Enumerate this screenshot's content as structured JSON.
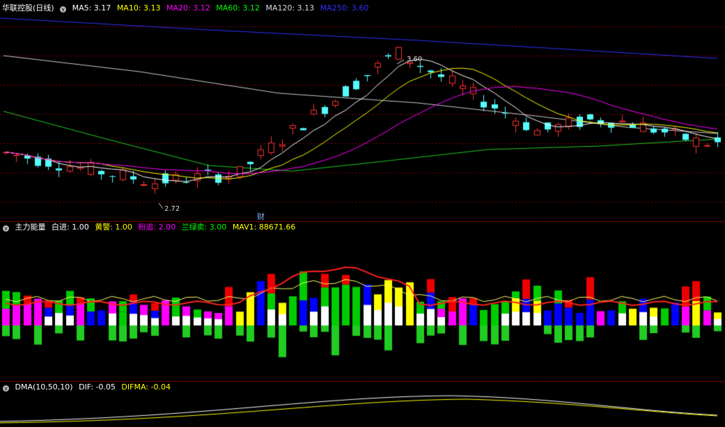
{
  "main": {
    "title": "华联控股(日线)",
    "ma": [
      {
        "label": "MA5: 3.17",
        "color": "#ffffff"
      },
      {
        "label": "MA10: 3.13",
        "color": "#ffff00"
      },
      {
        "label": "MA20: 3.12",
        "color": "#ff00ff"
      },
      {
        "label": "MA60: 3.12",
        "color": "#00ff00"
      },
      {
        "label": "MA120: 3.13",
        "color": "#dddddd"
      },
      {
        "label": "MA250: 3.60",
        "color": "#3030ff"
      }
    ],
    "high_note": "3.60",
    "low_note": "2.72",
    "finance_marker": "财"
  },
  "energy": {
    "title": "主力能量",
    "items": [
      {
        "label": "白进: 1.00",
        "color": "#ffffff"
      },
      {
        "label": "黄警: 1.00",
        "color": "#ffff00"
      },
      {
        "label": "粉追: 2.00",
        "color": "#ff00ff"
      },
      {
        "label": "兰绿卖: 3.00",
        "color": "#00ff00"
      },
      {
        "label": "MAV1: 88671.66",
        "color": "#ffff00"
      }
    ]
  },
  "dma": {
    "title": "DMA(10,50,10)",
    "items": [
      {
        "label": "DIF: -0.05",
        "color": "#ffffff"
      },
      {
        "label": "DIFMA: -0.04",
        "color": "#ffff00"
      }
    ]
  },
  "colors": {
    "up": "#ff3030",
    "down": "#54fcfc",
    "grid": "#8b0000",
    "bg": "#000000"
  }
}
